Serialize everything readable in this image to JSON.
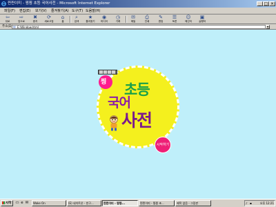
{
  "window": {
    "title": "찐찐이미 - 찡찡 초등 국어사전 - Microsoft Internet Explorer",
    "minimize": "_",
    "maximize": "□",
    "close": "×"
  },
  "menu": [
    "파일(F)",
    "편집(E)",
    "보기(V)",
    "즐겨찾기(A)",
    "도구(T)",
    "도움말(H)"
  ],
  "toolbar": [
    {
      "label": "뒤로",
      "icon": "back-arrow-icon",
      "glyph": "⇦"
    },
    {
      "label": "앞으로",
      "icon": "forward-arrow-icon",
      "glyph": "⇨"
    },
    {
      "label": "중지",
      "icon": "stop-icon",
      "glyph": "✖"
    },
    {
      "label": "새로고침",
      "icon": "refresh-icon",
      "glyph": "⟳"
    },
    {
      "label": "홈",
      "icon": "home-icon",
      "glyph": "⌂"
    },
    {
      "label": "검색",
      "icon": "search-icon",
      "glyph": "⌕"
    },
    {
      "label": "즐겨찾기",
      "icon": "favorites-icon",
      "glyph": "★"
    },
    {
      "label": "미디어",
      "icon": "media-icon",
      "glyph": "◉"
    },
    {
      "label": "기록",
      "icon": "history-icon",
      "glyph": "◷"
    },
    {
      "label": "메일",
      "icon": "mail-icon",
      "glyph": "✉"
    },
    {
      "label": "인쇄",
      "icon": "print-icon",
      "glyph": "⎙"
    },
    {
      "label": "편집",
      "icon": "edit-icon",
      "glyph": "✎"
    },
    {
      "label": "토론",
      "icon": "discuss-icon",
      "glyph": "☰"
    },
    {
      "label": "메신저",
      "icon": "messenger-icon",
      "glyph": "☺"
    },
    {
      "label": "실행하",
      "icon": "run-icon",
      "glyph": "▣"
    }
  ],
  "address": {
    "label": "주소(D)",
    "value": "E:\\Window.html"
  },
  "content": {
    "logo_jjing": "찡",
    "logo_chodeung": "초등",
    "logo_gugeo": "국어",
    "logo_sajeon": "사전",
    "start_button": "시작하기"
  },
  "taskbar": {
    "start_label": "시작",
    "tasks": [
      {
        "label": "Wake On",
        "active": false
      },
      {
        "label": "(E) 네이트온 - 친구...",
        "active": false
      },
      {
        "label": "찐찐이미 - 찡찡...",
        "active": true
      },
      {
        "label": "찐찐이미 - 찡찡 초...",
        "active": false
      },
      {
        "label": "제목 없음 - 그림판",
        "active": false
      }
    ],
    "clock": "오후 12:21"
  },
  "colors": {
    "content_bg": "#bfeffa",
    "badge_yellow": "#f4f01e",
    "accent_pink": "#ee1f76",
    "green": "#19a04a",
    "purple": "#7a1a8e",
    "titlebar": "#0a246a"
  }
}
